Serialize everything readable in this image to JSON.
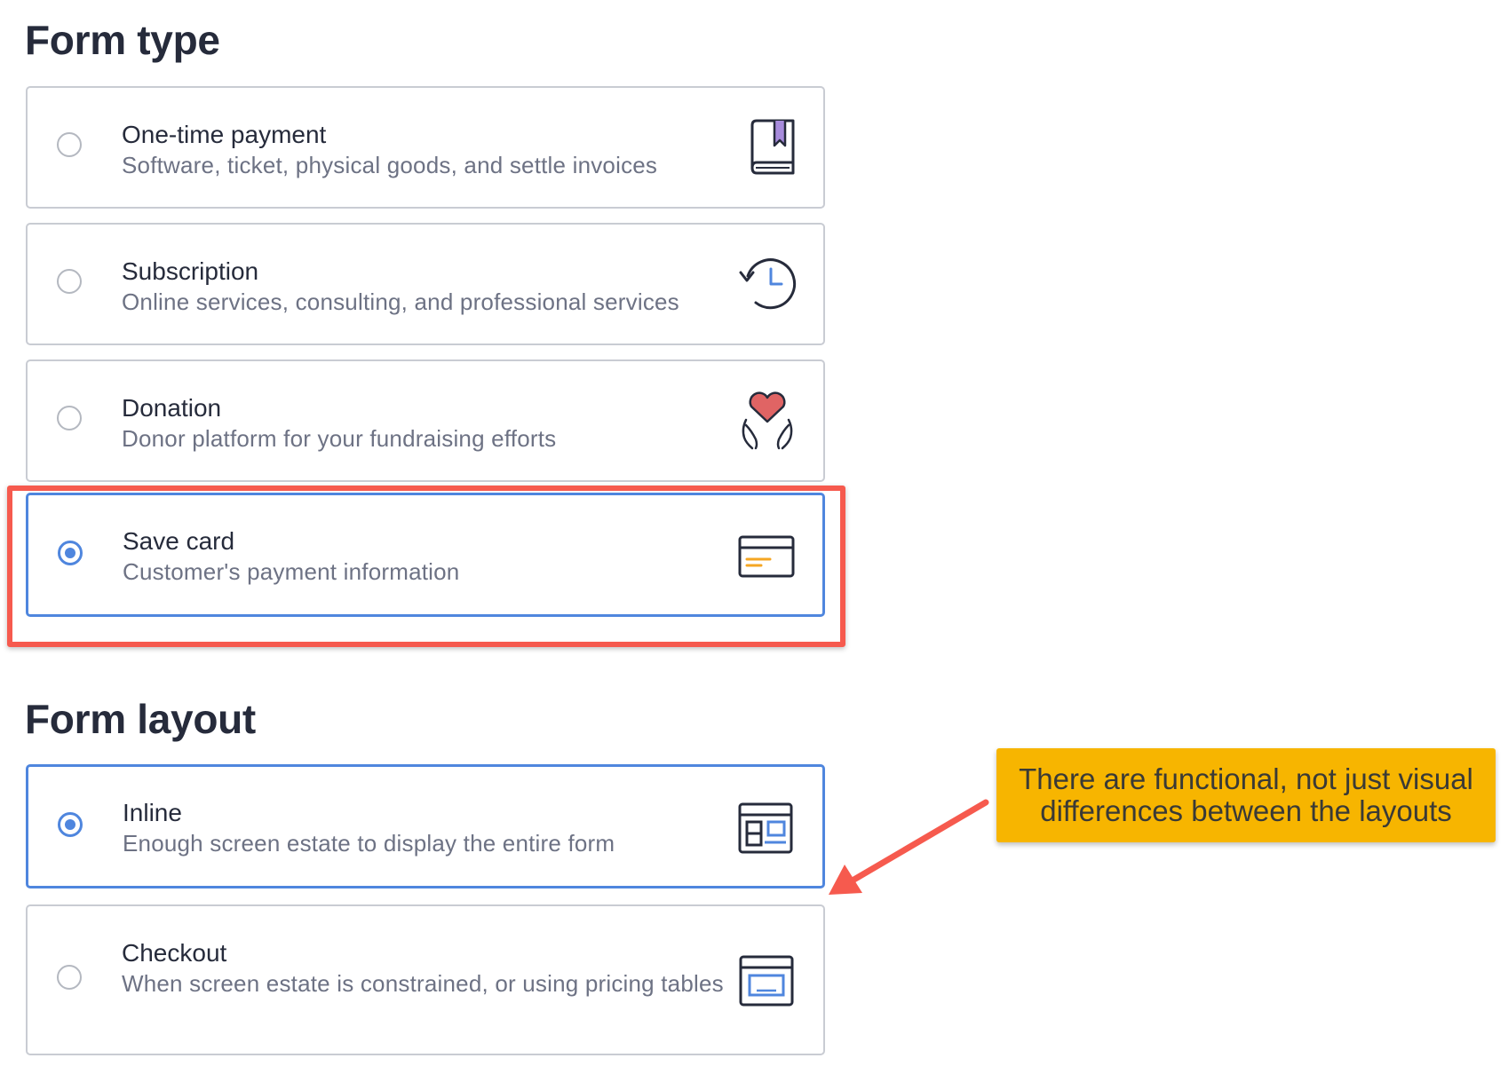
{
  "form_type": {
    "title": "Form type",
    "options": [
      {
        "label": "One-time payment",
        "description": "Software, ticket, physical goods, and settle invoices",
        "icon": "book-bookmark-icon",
        "selected": false
      },
      {
        "label": "Subscription",
        "description": "Online services, consulting, and professional services",
        "icon": "clock-history-icon",
        "selected": false
      },
      {
        "label": "Donation",
        "description": "Donor platform for your fundraising efforts",
        "icon": "heart-hands-icon",
        "selected": false
      },
      {
        "label": "Save card",
        "description": "Customer's payment information",
        "icon": "credit-card-icon",
        "selected": true
      }
    ]
  },
  "form_layout": {
    "title": "Form layout",
    "options": [
      {
        "label": "Inline",
        "description": "Enough screen estate to display the entire form",
        "icon": "inline-layout-icon",
        "selected": true
      },
      {
        "label": "Checkout",
        "description": "When screen estate is constrained, or using pricing tables",
        "icon": "checkout-window-icon",
        "selected": false
      }
    ]
  },
  "annotation": {
    "callout_text": "There are functional, not just visual differences between the layouts",
    "highlight_color": "#f65a4e",
    "callout_color": "#f7b500"
  },
  "colors": {
    "accent": "#4f86de",
    "border": "#c9ccd3",
    "heading": "#262b3b",
    "muted": "#6d7284"
  }
}
